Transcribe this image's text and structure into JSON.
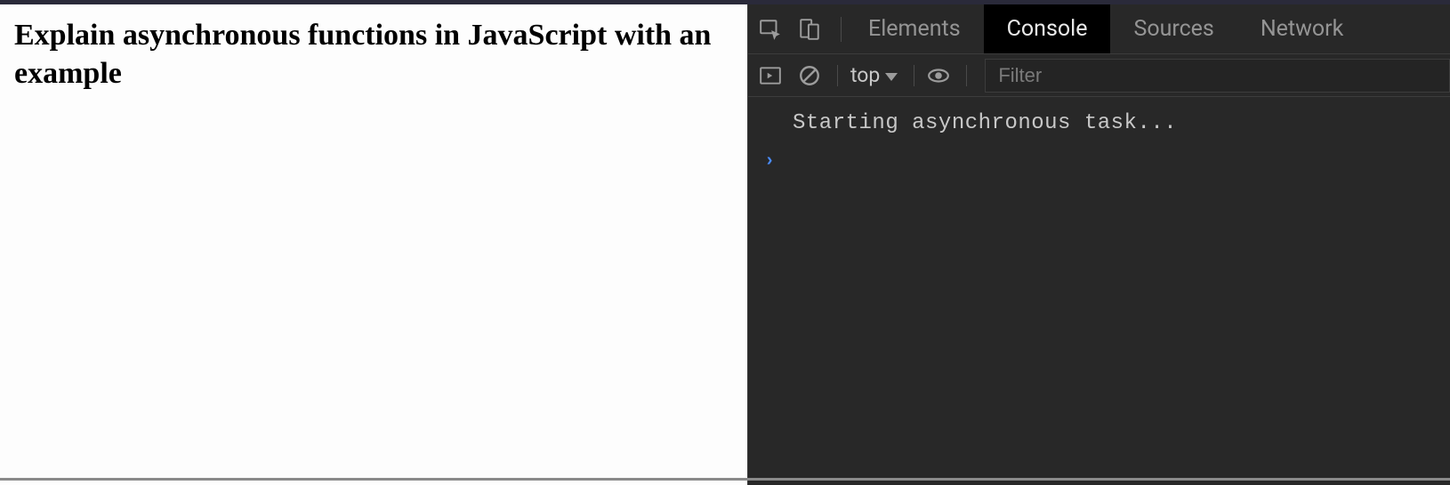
{
  "page": {
    "heading": "Explain asynchronous functions in JavaScript with an example"
  },
  "devtools": {
    "tabs": [
      {
        "label": "Elements",
        "active": false
      },
      {
        "label": "Console",
        "active": true
      },
      {
        "label": "Sources",
        "active": false
      },
      {
        "label": "Network",
        "active": false
      }
    ],
    "toolbar": {
      "context_label": "top",
      "filter_placeholder": "Filter"
    },
    "console": {
      "logs": [
        "Starting asynchronous task..."
      ],
      "prompt_symbol": "›"
    }
  }
}
